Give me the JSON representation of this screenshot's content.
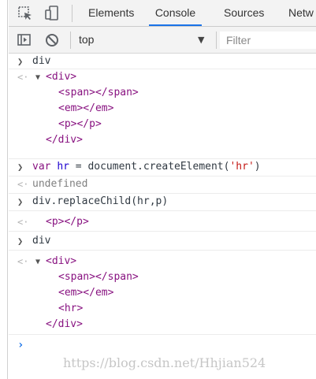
{
  "tabs": [
    {
      "label": "Elements",
      "active": false
    },
    {
      "label": "Console",
      "active": true
    },
    {
      "label": "Sources",
      "active": false
    },
    {
      "label": "Netw",
      "active": false
    }
  ],
  "toolbar": {
    "context": "top",
    "filter_placeholder": "Filter"
  },
  "console": {
    "entry1_input": "div",
    "entry1_tags": [
      "<div>",
      "<span></span>",
      "<em></em>",
      "<p></p>",
      "</div>"
    ],
    "entry2_kw": "var",
    "entry2_var": "hr",
    "entry2_mid": " = document.createElement(",
    "entry2_str": "'hr'",
    "entry2_end": ")",
    "entry2_result": "undefined",
    "entry3_input": "div.replaceChild(hr,p)",
    "entry3_result": "<p></p>",
    "entry4_input": "div",
    "entry4_tags": [
      "<div>",
      "<span></span>",
      "<em></em>",
      "<hr>",
      "</div>"
    ]
  },
  "watermark": "https://blog.csdn.net/Hhjian524",
  "colors": {
    "accent": "#1a73e8",
    "tag": "#881280",
    "string": "#c41a16",
    "keyword_var": "#1c00cf"
  }
}
